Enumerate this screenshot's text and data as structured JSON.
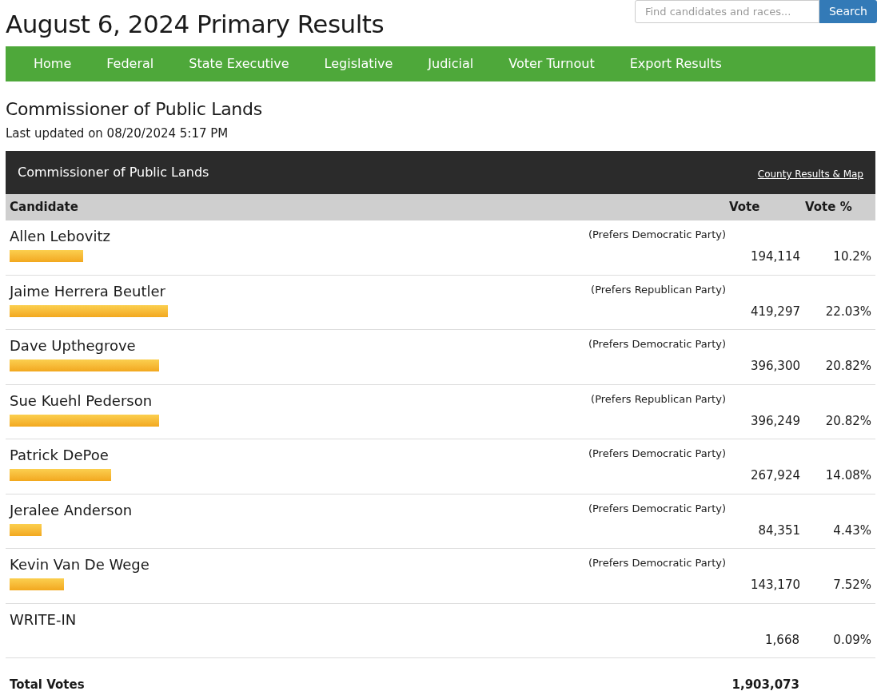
{
  "page_title": "August 6, 2024 Primary Results",
  "search": {
    "placeholder": "Find candidates and races...",
    "button": "Search"
  },
  "nav": [
    "Home",
    "Federal",
    "State Executive",
    "Legislative",
    "Judicial",
    "Voter Turnout",
    "Export Results"
  ],
  "race_heading": "Commissioner of Public Lands",
  "updated": "Last updated on 08/20/2024 5:17 PM",
  "panel": {
    "title": "Commissioner of Public Lands",
    "link": "County Results & Map"
  },
  "table": {
    "columns": [
      "Candidate",
      "Vote",
      "Vote %"
    ],
    "rows": [
      {
        "name": "Allen Lebovitz",
        "party": "(Prefers Democratic Party)",
        "level": 0.102,
        "votes": "194,114",
        "percent": "10.2%"
      },
      {
        "name": "Jaime Herrera Beutler",
        "party": "(Prefers Republican Party)",
        "level": 0.2203,
        "votes": "419,297",
        "percent": "22.03%"
      },
      {
        "name": "Dave Upthegrove",
        "party": "(Prefers Democratic Party)",
        "level": 0.2082,
        "votes": "396,300",
        "percent": "20.82%"
      },
      {
        "name": "Sue Kuehl Pederson",
        "party": "(Prefers Republican Party)",
        "level": 0.2082,
        "votes": "396,249",
        "percent": "20.82%"
      },
      {
        "name": "Patrick DePoe",
        "party": "(Prefers Democratic Party)",
        "level": 0.1408,
        "votes": "267,924",
        "percent": "14.08%"
      },
      {
        "name": "Jeralee Anderson",
        "party": "(Prefers Democratic Party)",
        "level": 0.0443,
        "votes": "84,351",
        "percent": "4.43%"
      },
      {
        "name": "Kevin Van De Wege",
        "party": "(Prefers Democratic Party)",
        "level": 0.0752,
        "votes": "143,170",
        "percent": "7.52%"
      },
      {
        "name": "WRITE-IN",
        "votes": "1,668",
        "percent": "0.09%"
      }
    ],
    "total": {
      "label": "Total Votes",
      "votes": "1,903,073"
    }
  }
}
